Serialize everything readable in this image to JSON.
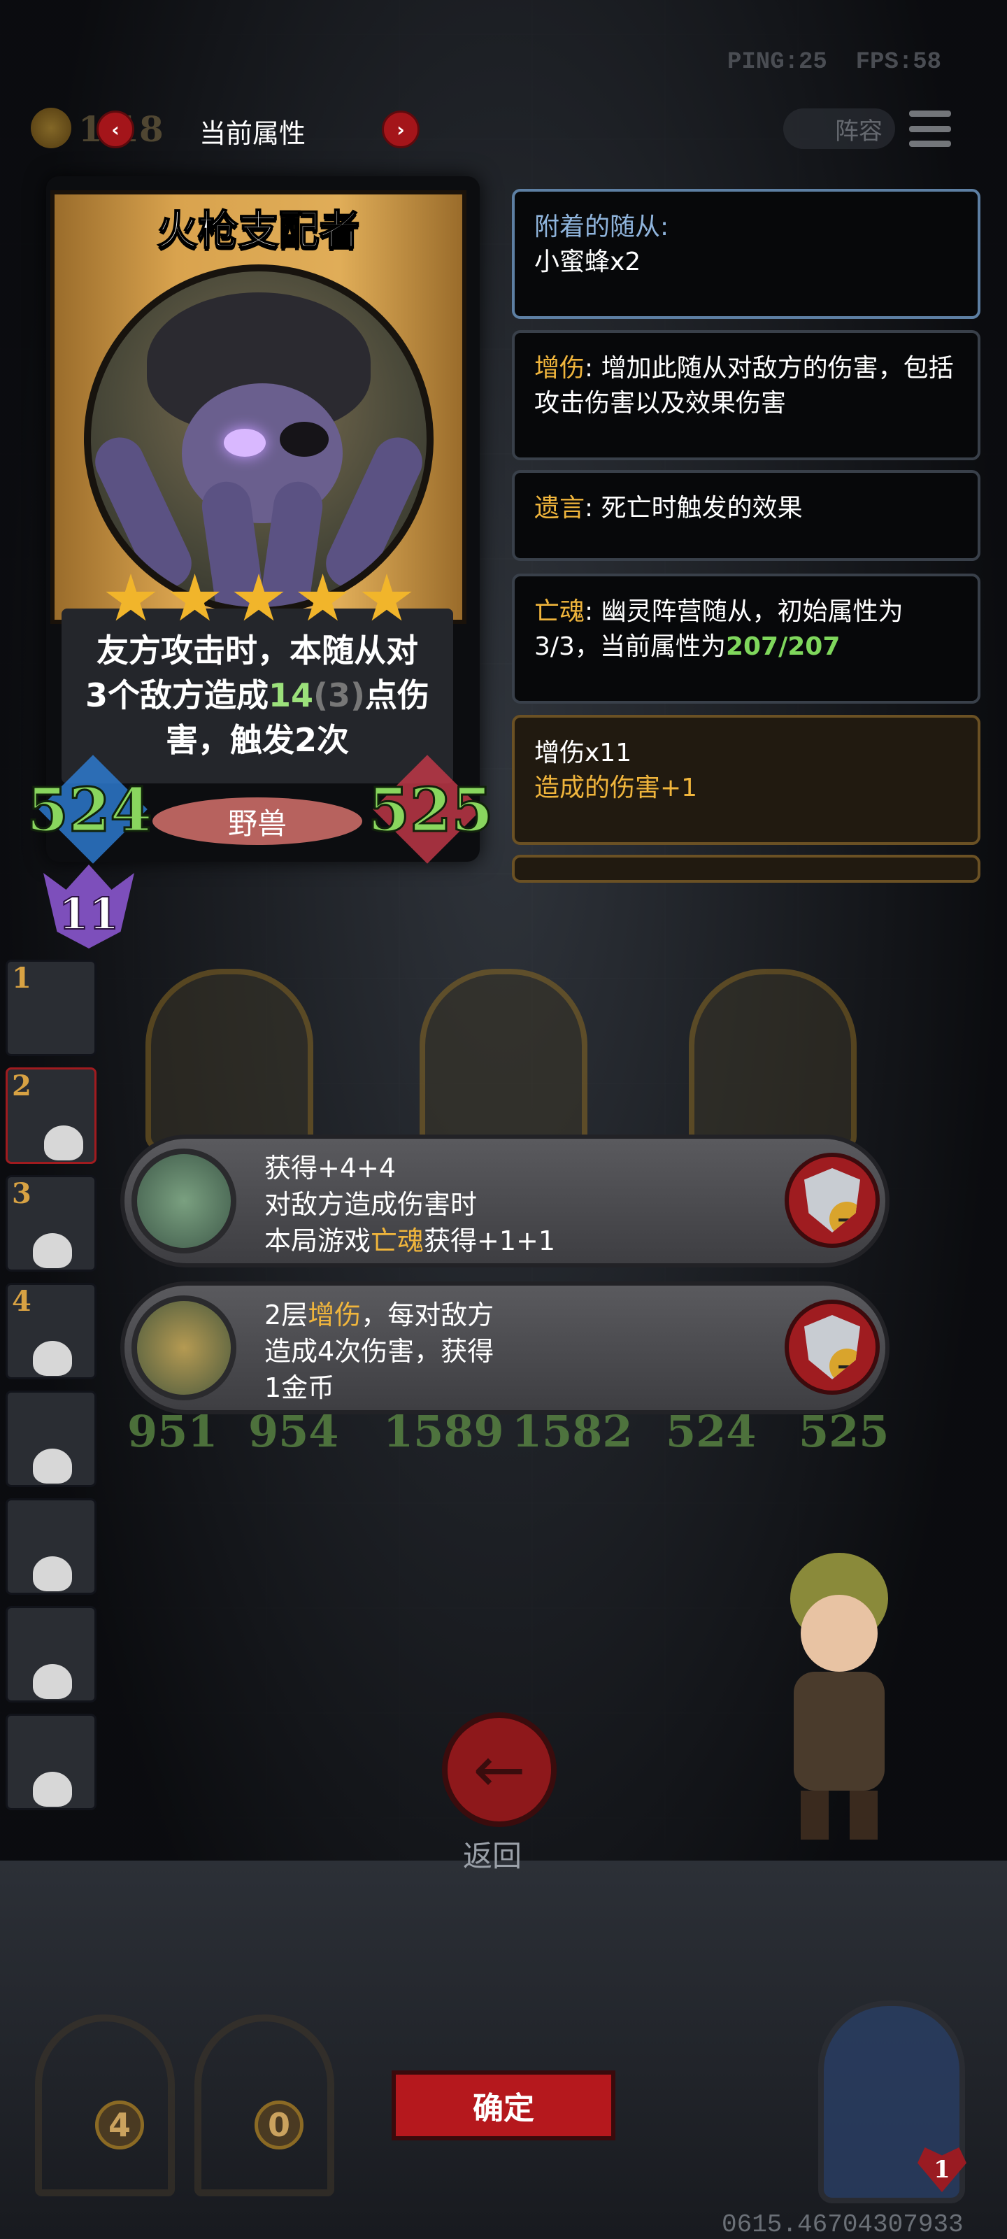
{
  "hud": {
    "ping": "PING:25",
    "fps": "FPS:58",
    "coins": "1  18",
    "title": "当前属性",
    "lineup": "阵容",
    "prev_symbol": "‹",
    "next_symbol": "›"
  },
  "card": {
    "name": "火枪支配者",
    "stars": 5,
    "desc_line1": "友方攻击时，本随从对",
    "desc_l2_pre": "3个敌方造成",
    "desc_l2_hl": "14",
    "desc_l2_dim": "(3)",
    "desc_l2_post": "点伤",
    "desc_line3": "害，触发2次",
    "attack": "524",
    "health": "525",
    "tribe": "野兽",
    "level": "11"
  },
  "panels": {
    "attached_label": "附着的随从:",
    "attached_value": "小蜜蜂x2",
    "kw1_name": "增伤",
    "kw1_text": ": 增加此随从对敌方的伤害，包括攻击伤害以及效果伤害",
    "kw2_name": "遗言",
    "kw2_text": ": 死亡时触发的效果",
    "kw3_name": "亡魂",
    "kw3_text": ": 幽灵阵营随从，初始属性为3/3，当前属性为",
    "kw3_value": "207/207",
    "buff_title": "增伤x11",
    "buff_sub": "造成的伤害+1"
  },
  "side": [
    "1",
    "2",
    "3",
    "4"
  ],
  "minions": {
    "stats": [
      "951",
      "954",
      "1589",
      "1582",
      "524",
      "525"
    ]
  },
  "buffs": [
    {
      "line1": "获得+4+4",
      "line2": "对敌方造成伤害时",
      "line3_pre": "本局游戏",
      "line3_kw": "亡魂",
      "line3_post": "获得+1+1"
    },
    {
      "line1_pre": "2层",
      "line1_kw": "增伤",
      "line1_post": "，每对敌方",
      "line2": "造成4次伤害，获得",
      "line3": "1金币"
    }
  ],
  "controls": {
    "back_label": "返回",
    "confirm_label": "确定",
    "chest_left": "4",
    "chest_right": "0",
    "hp_count": "1",
    "coords": "0615.46704307933",
    "back_symbol": "←",
    "minus_symbol": "−"
  }
}
